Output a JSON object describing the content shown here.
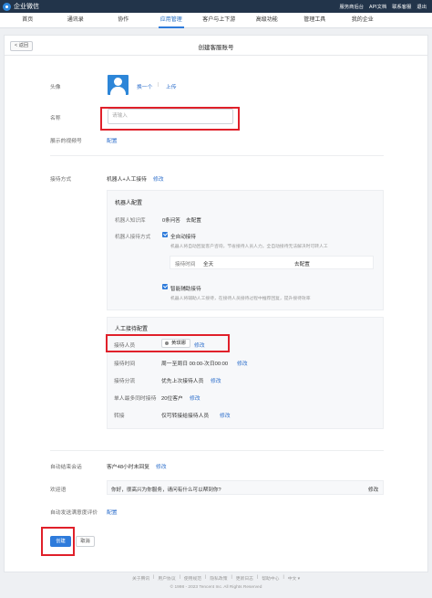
{
  "topbar": {
    "logo_text": "企业微信",
    "links": [
      "服务商后台",
      "API文档",
      "联系客服",
      "退出"
    ]
  },
  "nav": {
    "items": [
      "首页",
      "通讯录",
      "协作",
      "应用管理",
      "客户与上下游",
      "高级功能",
      "管理工具",
      "我的企业"
    ],
    "active_index": 3
  },
  "page": {
    "back_label": "返回",
    "title": "创建客服账号"
  },
  "form": {
    "avatar_label": "头像",
    "avatar_change": "换一个",
    "avatar_upload": "上传",
    "name_label": "名称",
    "name_placeholder": "请输入",
    "video_label": "展示的视频号",
    "video_action": "配置",
    "reception_label": "接待方式",
    "reception_value": "机器人+人工接待",
    "reception_edit": "修改"
  },
  "robot": {
    "title": "机器人配置",
    "kb_label": "机器人知识库",
    "kb_value": "0条问答",
    "kb_action": "去配置",
    "mode_label": "机器人接待方式",
    "auto_label": "全自动接待",
    "auto_desc": "机器人将自动回复客户咨询，节省接待人员人力。全自动接待无法解决时可转人工",
    "time_label": "接待时间",
    "time_value": "全天",
    "time_action": "去配置",
    "assist_label": "智能辅助接待",
    "assist_desc": "机器人将辅助人工接待，在接待人员接待过程中推荐回复，提升接待效率"
  },
  "human": {
    "title": "人工接待配置",
    "staff_label": "接待人员",
    "staff_name": "黄琪娜",
    "staff_edit": "修改",
    "time_label": "接待时间",
    "time_value": "周一至周日 00:00-次日00:00",
    "time_edit": "修改",
    "dist_label": "接待分流",
    "dist_value": "优先上次接待人员",
    "dist_edit": "修改",
    "max_label": "单人最多同时接待",
    "max_value": "20位客户",
    "max_edit": "修改",
    "transfer_label": "转接",
    "transfer_value": "仅可转接给接待人员",
    "transfer_edit": "修改"
  },
  "session": {
    "end_label": "自动结束会话",
    "end_value": "客户48小时未回复",
    "end_edit": "修改",
    "welcome_label": "欢迎语",
    "welcome_value": "你好，很高兴为你服务，请问有什么可以帮到你?",
    "welcome_edit": "修改",
    "survey_label": "自动发送满意度评价",
    "survey_action": "配置"
  },
  "actions": {
    "create": "创建",
    "cancel": "取消"
  },
  "footer": {
    "links": [
      "关于腾讯",
      "用户协议",
      "使用规范",
      "隐私政策",
      "更新日志",
      "帮助中心",
      "中文 ▾"
    ],
    "copyright": "© 1998 - 2023 Tencent Inc. All Rights Reserved"
  },
  "colors": {
    "topbar": "#22344a",
    "accent": "#2e7bdb",
    "link": "#2c6ecb",
    "highlight": "#e0202a"
  }
}
